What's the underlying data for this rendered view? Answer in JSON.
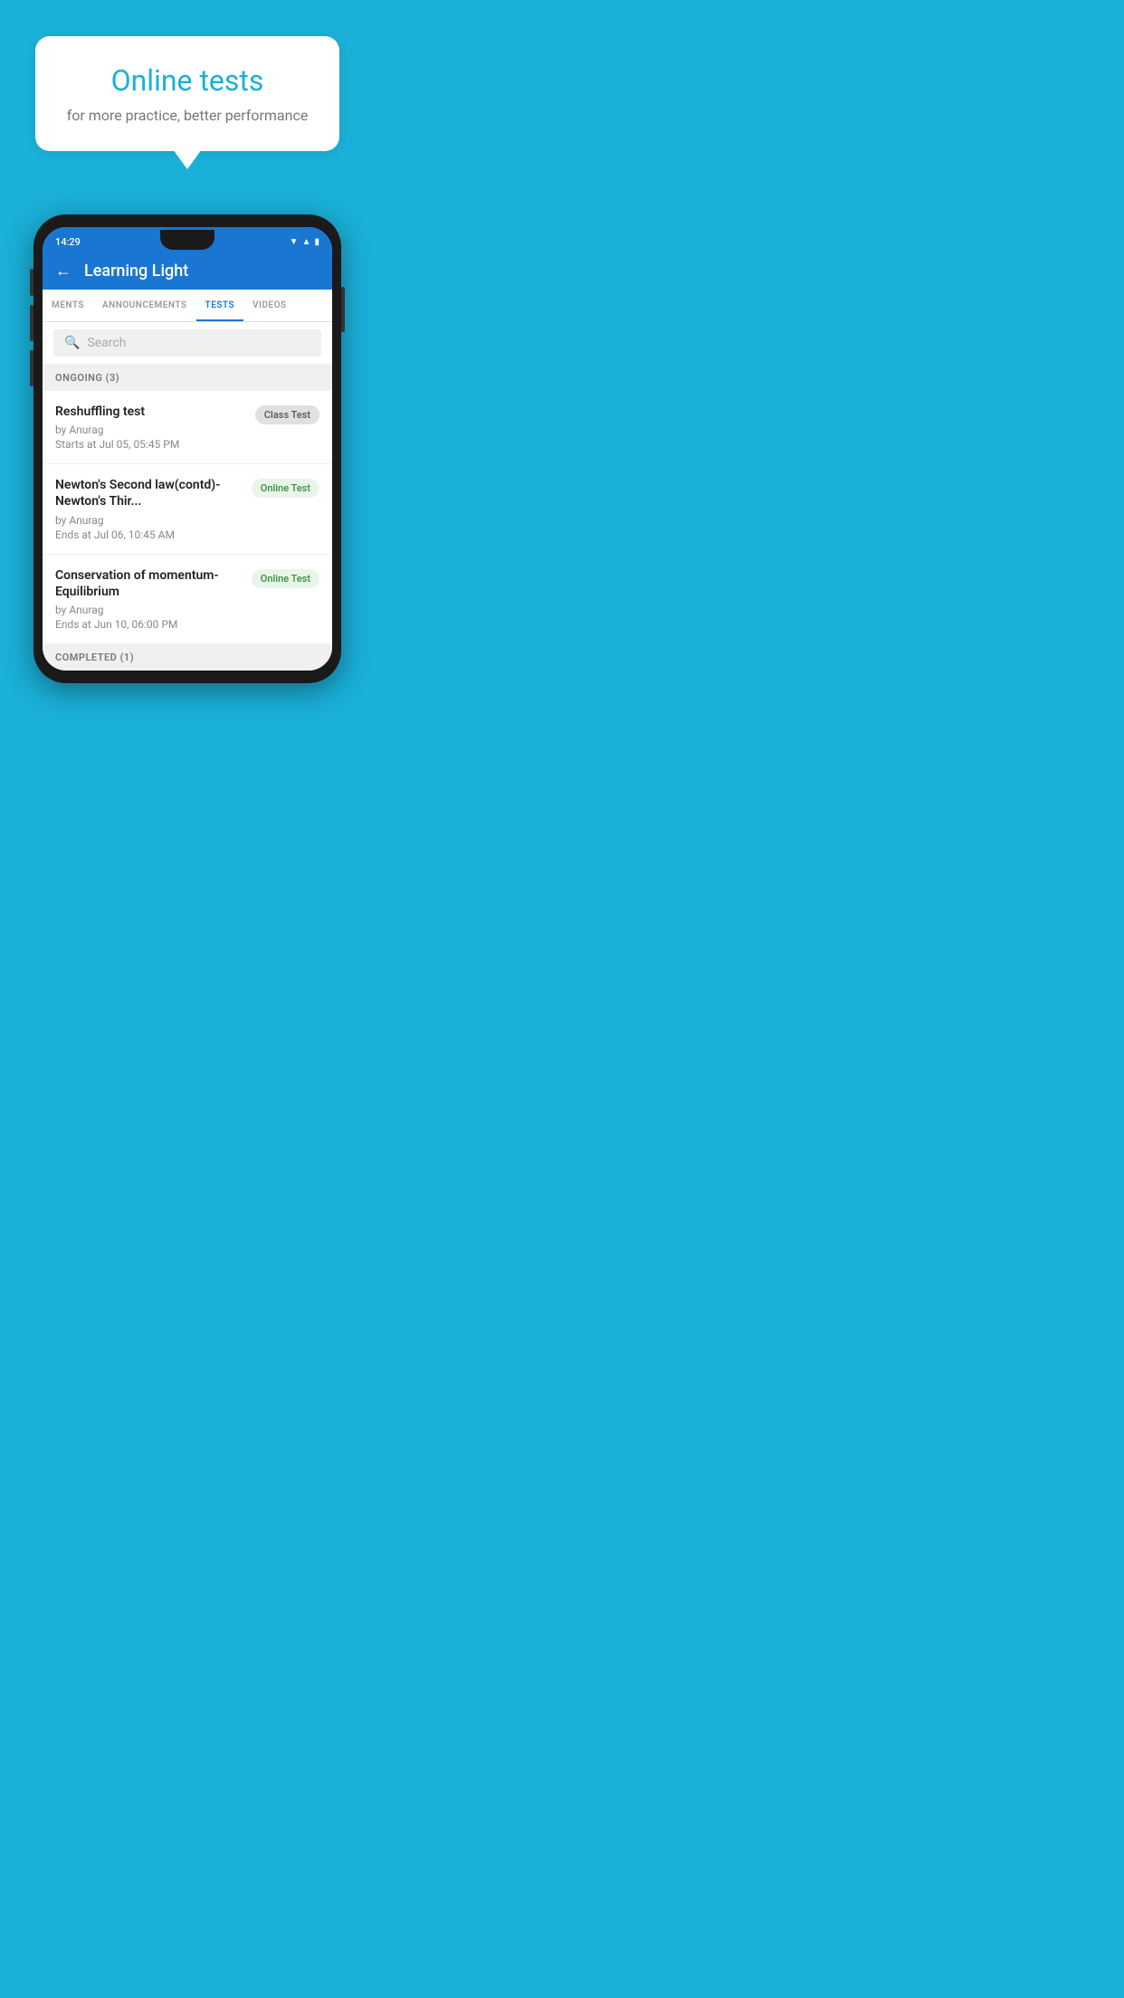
{
  "background_color": "#1ab0d8",
  "bubble": {
    "title": "Online tests",
    "subtitle": "for more practice, better performance"
  },
  "phone": {
    "status_bar": {
      "time": "14:29",
      "wifi_icon": "▲",
      "signal_icon": "▲",
      "battery_icon": "▮"
    },
    "header": {
      "back_icon": "←",
      "title": "Learning Light"
    },
    "tabs": [
      {
        "label": "MENTS",
        "active": false
      },
      {
        "label": "ANNOUNCEMENTS",
        "active": false
      },
      {
        "label": "TESTS",
        "active": true
      },
      {
        "label": "VIDEOS",
        "active": false
      }
    ],
    "search": {
      "placeholder": "Search"
    },
    "ongoing_section": {
      "label": "ONGOING (3)"
    },
    "tests": [
      {
        "name": "Reshuffling test",
        "author": "by Anurag",
        "date_label": "Starts at",
        "date": "Jul 05, 05:45 PM",
        "badge": "Class Test",
        "badge_type": "class"
      },
      {
        "name": "Newton's Second law(contd)-Newton's Thir...",
        "author": "by Anurag",
        "date_label": "Ends at",
        "date": "Jul 06, 10:45 AM",
        "badge": "Online Test",
        "badge_type": "online"
      },
      {
        "name": "Conservation of momentum-Equilibrium",
        "author": "by Anurag",
        "date_label": "Ends at",
        "date": "Jun 10, 06:00 PM",
        "badge": "Online Test",
        "badge_type": "online"
      }
    ],
    "completed_section": {
      "label": "COMPLETED (1)"
    }
  }
}
